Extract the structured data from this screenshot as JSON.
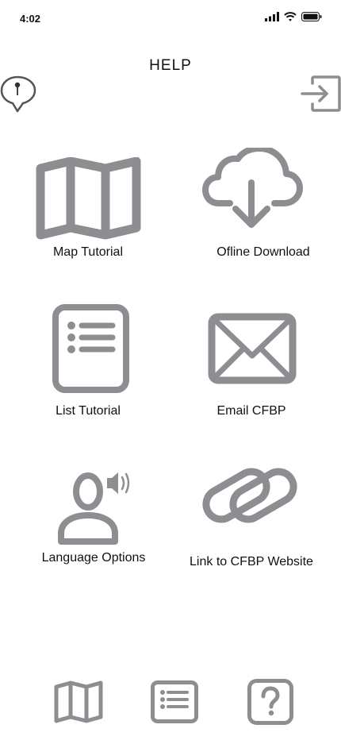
{
  "status_bar": {
    "time": "4:02"
  },
  "header": {
    "title": "HELP"
  },
  "tiles": [
    {
      "label": "Map Tutorial"
    },
    {
      "label": "Ofline Download"
    },
    {
      "label": "List Tutorial"
    },
    {
      "label": "Email CFBP"
    },
    {
      "label": "Language Options"
    },
    {
      "label": "Link to CFBP Website"
    }
  ],
  "icons": {
    "color": "#8e8e92",
    "top_left": "map-pin-icon",
    "top_right": "sign-in-icon",
    "tab_bar": [
      "map-icon",
      "list-icon",
      "help-icon"
    ]
  }
}
